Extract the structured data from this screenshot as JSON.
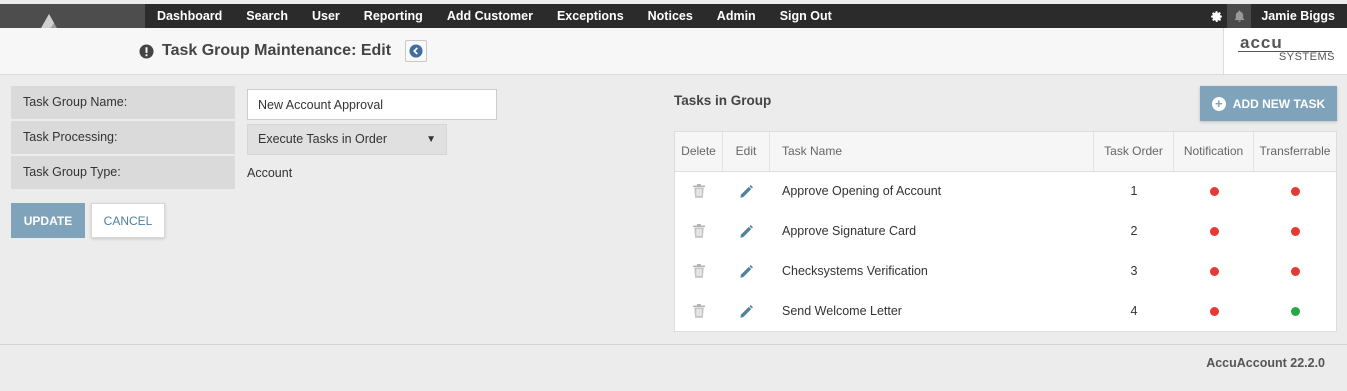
{
  "nav": {
    "items": [
      "Dashboard",
      "Search",
      "User",
      "Reporting",
      "Add Customer",
      "Exceptions",
      "Notices",
      "Admin",
      "Sign Out"
    ],
    "user_name": "Jamie Biggs",
    "icons": [
      "gear-icon",
      "bell-icon"
    ]
  },
  "header": {
    "title": "Task Group Maintenance: Edit",
    "brand_top": "accu",
    "brand_bottom": "SYSTEMS"
  },
  "form": {
    "name_label": "Task Group Name:",
    "name_value": "New Account Approval",
    "processing_label": "Task Processing:",
    "processing_value": "Execute Tasks in Order",
    "type_label": "Task Group Type:",
    "type_value": "Account",
    "update_label": "UPDATE",
    "cancel_label": "CANCEL"
  },
  "tasks": {
    "title": "Tasks in Group",
    "add_label": "ADD NEW TASK",
    "columns": [
      "Delete",
      "Edit",
      "Task Name",
      "Task Order",
      "Notification",
      "Transferrable"
    ],
    "rows": [
      {
        "name": "Approve Opening of Account",
        "order": "1",
        "notification": "red",
        "transferrable": "red"
      },
      {
        "name": "Approve Signature Card",
        "order": "2",
        "notification": "red",
        "transferrable": "red"
      },
      {
        "name": "Checksystems Verification",
        "order": "3",
        "notification": "red",
        "transferrable": "red"
      },
      {
        "name": "Send Welcome Letter",
        "order": "4",
        "notification": "red",
        "transferrable": "green"
      }
    ]
  },
  "footer": {
    "version": "AccuAccount 22.2.0"
  },
  "colors": {
    "accent": "#7fa3bb",
    "nav_bg": "#2b2b2b",
    "red": "#e53935",
    "green": "#27a745"
  }
}
